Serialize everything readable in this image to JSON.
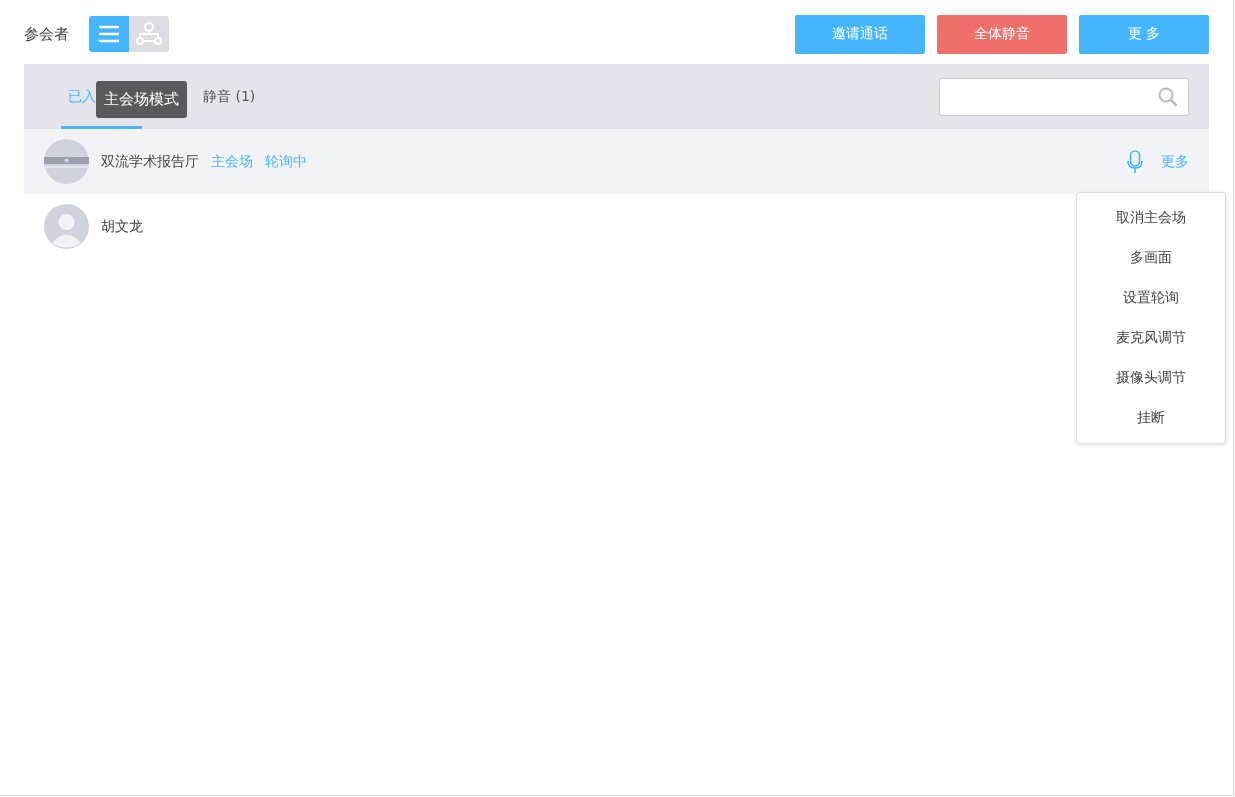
{
  "header": {
    "title": "参会者",
    "view_modes": [
      {
        "kind": "list",
        "selected": true
      },
      {
        "kind": "tree",
        "selected": false
      }
    ],
    "buttons": [
      {
        "label": "邀请通话",
        "kind": "primary"
      },
      {
        "label": "全体静音",
        "kind": "danger"
      },
      {
        "label": "更 多",
        "kind": "primary"
      }
    ]
  },
  "tooltip": {
    "text": "主会场模式"
  },
  "tabs": [
    {
      "label": "已入",
      "selected": true
    },
    {
      "label": "静音 (1)",
      "selected": false
    }
  ],
  "participants": [
    {
      "name": "双流学术报告厅",
      "kind": "room",
      "selected": true,
      "tags": [
        "主会场",
        "轮询中"
      ],
      "actions": [
        {
          "kind": "mic"
        },
        {
          "kind": "link",
          "label": "更多"
        }
      ]
    },
    {
      "name": "胡文龙",
      "kind": "person",
      "selected": false
    }
  ],
  "menu": {
    "items": [
      "取消主会场",
      "多画面",
      "设置轮询",
      "麦克风调节",
      "摄像头调节",
      "挂断"
    ]
  }
}
